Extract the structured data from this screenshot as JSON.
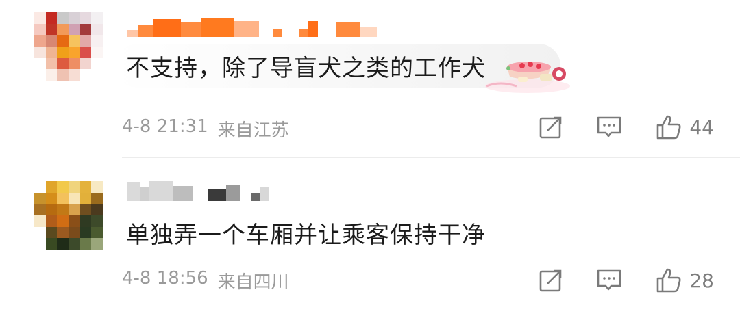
{
  "comments": [
    {
      "text": "不支持，除了导盲犬之类的工作犬",
      "time": "4-8 21:31",
      "location": "来自江苏",
      "likes": "44"
    },
    {
      "text": "单独弄一个车厢并让乘客保持干净",
      "time": "4-8 18:56",
      "location": "来自四川",
      "likes": "28"
    }
  ],
  "icons": {
    "share": "share-icon",
    "reply": "comment-icon",
    "like": "thumbs-up-icon",
    "sticker": "fruit-bowl-icon"
  },
  "colors": {
    "meta_text": "#9a9a9a",
    "icon_stroke": "#7a7a7a",
    "name_accent": "#ff7a1f",
    "divider": "#ececec"
  }
}
